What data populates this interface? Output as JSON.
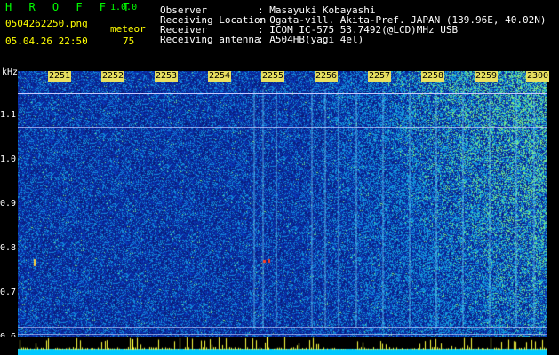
{
  "header": {
    "app_name": "H R O F F T",
    "version": "1.0.0",
    "filename": "0504262250.png",
    "datetime": "05.04.26 22:50",
    "meteor_label": "meteor",
    "meteor_count": "75",
    "fields": [
      {
        "label": "Observer",
        "value": ": Masayuki Kobayashi"
      },
      {
        "label": "Receiving Location",
        "value": ": Ogata-vill. Akita-Pref. JAPAN (139.96E, 40.02N)"
      },
      {
        "label": "Receiver",
        "value": ": ICOM IC-575 53.7492(@LCD)MHz USB"
      },
      {
        "label": "Receiving antenna",
        "value": ": A504HB(yagi 4el)"
      }
    ]
  },
  "spectrogram": {
    "y_unit": "kHz",
    "y_ticks": [
      "1.1",
      "1.0",
      "0.9",
      "0.8",
      "0.7",
      "0.6"
    ],
    "time_ticks": [
      "2251",
      "2252",
      "2253",
      "2254",
      "2255",
      "2256",
      "2257",
      "2258",
      "2259",
      "2300"
    ]
  }
}
